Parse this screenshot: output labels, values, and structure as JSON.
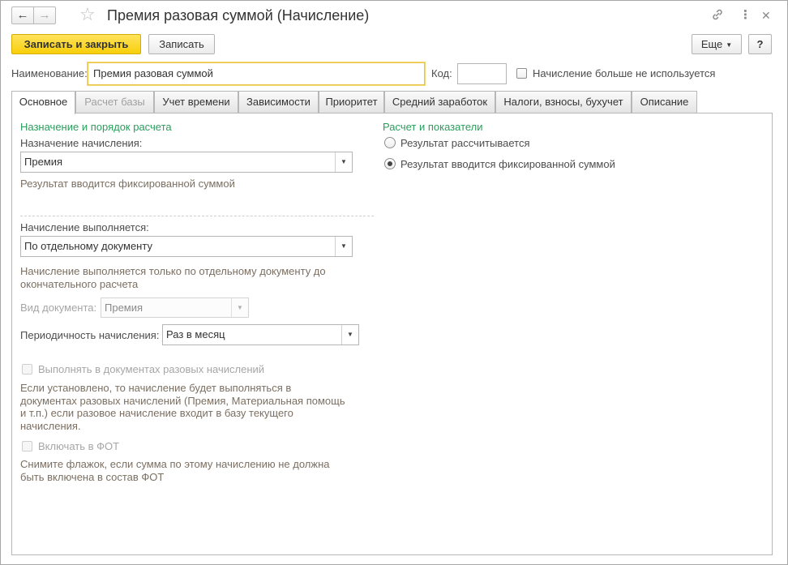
{
  "window": {
    "title": "Премия разовая суммой (Начисление)",
    "icons": {
      "back": "arrow-left-icon",
      "forward": "arrow-right-icon",
      "favorite": "star-icon",
      "link": "link-icon",
      "menu": "more-vertical-icon",
      "close": "close-icon"
    }
  },
  "toolbar": {
    "save_close_label": "Записать и закрыть",
    "save_label": "Записать",
    "more_label": "Еще",
    "help_label": "?"
  },
  "header": {
    "name_label": "Наименование:",
    "name_value": "Премия разовая суммой",
    "code_label": "Код:",
    "code_value": "",
    "not_used_label": "Начисление больше не используется"
  },
  "tabs": [
    {
      "label": "Основное"
    },
    {
      "label": "Расчет базы"
    },
    {
      "label": "Учет времени"
    },
    {
      "label": "Зависимости"
    },
    {
      "label": "Приоритет"
    },
    {
      "label": "Средний заработок"
    },
    {
      "label": "Налоги, взносы, бухучет"
    },
    {
      "label": "Описание"
    }
  ],
  "main": {
    "purpose_section": "Назначение и порядок расчета",
    "purpose_label": "Назначение начисления:",
    "purpose_value": "Премия",
    "purpose_hint": "Результат вводится фиксированной суммой",
    "execution_label": "Начисление выполняется:",
    "execution_value": "По отдельному документу",
    "execution_hint_1": "Начисление выполняется только по отдельному документу до",
    "execution_hint_2": "окончательного расчета",
    "doc_type_label": "Вид документа:",
    "doc_type_value": "Премия",
    "periodicity_label": "Периодичность начисления:",
    "periodicity_value": "Раз в месяц",
    "one_time_label": "Выполнять в документах разовых начислений",
    "one_time_hint_1": "Если установлено, то начисление будет выполняться в",
    "one_time_hint_2": "документах разовых начислений (Премия, Материальная помощь",
    "one_time_hint_3": "и т.п.) если разовое начисление входит в базу текущего",
    "one_time_hint_4": "начисления.",
    "fot_label": "Включать в ФОТ",
    "fot_hint_1": "Снимите флажок, если сумма по этому начислению не должна",
    "fot_hint_2": "быть включена в состав ФОТ",
    "calc_section": "Расчет и показатели",
    "radio_calculated": "Результат рассчитывается",
    "radio_fixed": "Результат вводится фиксированной суммой"
  },
  "colors": {
    "accent_yellow": "#f8cf0a",
    "section_green": "#2a9d5c",
    "hint_brown": "#7b6f62"
  }
}
